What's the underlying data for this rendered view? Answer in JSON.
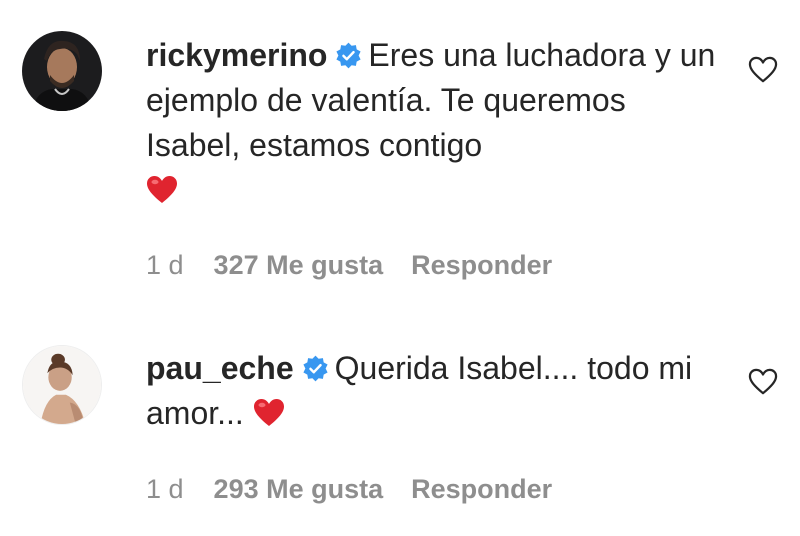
{
  "comments": [
    {
      "username": "rickymerino",
      "text": "Eres una luchadora y un ejemplo de valentía. Te queremos Isabel, estamos contigo",
      "time": "1 d",
      "likes": "327 Me gusta",
      "reply": "Responder",
      "avatar_icon": "avatar-man-icon",
      "emoji": "red-heart-icon"
    },
    {
      "username": "pau_eche",
      "text": "Querida Isabel.... todo mi amor...",
      "time": "1 d",
      "likes": "293 Me gusta",
      "reply": "Responder",
      "avatar_icon": "avatar-woman-icon",
      "emoji": "red-heart-icon"
    }
  ],
  "colors": {
    "text": "#262626",
    "secondary": "#8e8e8e",
    "verified": "#3897f0",
    "heart_emoji": "#e0242f"
  }
}
